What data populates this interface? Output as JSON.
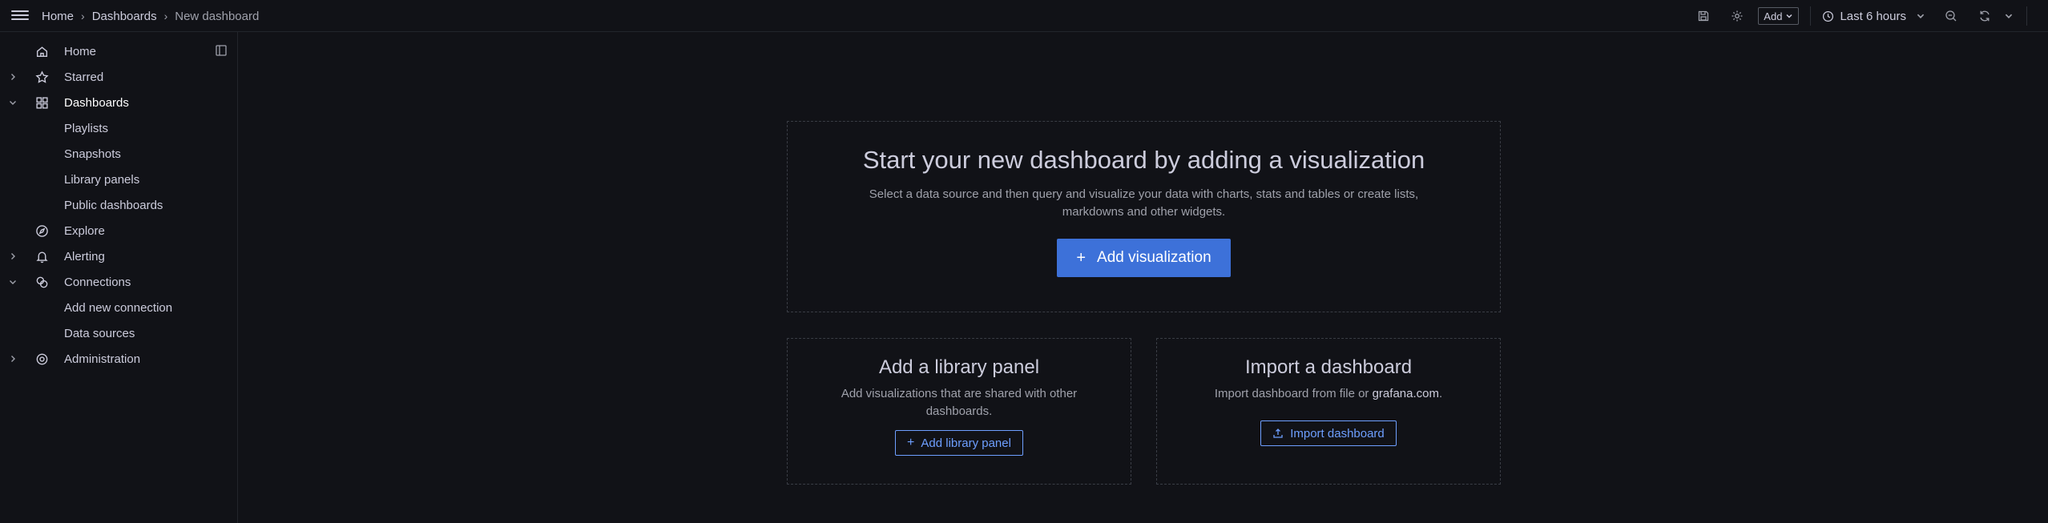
{
  "breadcrumb": {
    "home": "Home",
    "dashboards": "Dashboards",
    "current": "New dashboard"
  },
  "toolbar": {
    "add_label": "Add",
    "time_range": "Last 6 hours"
  },
  "sidebar": {
    "items": [
      {
        "label": "Home"
      },
      {
        "label": "Starred"
      },
      {
        "label": "Dashboards"
      },
      {
        "label": "Playlists"
      },
      {
        "label": "Snapshots"
      },
      {
        "label": "Library panels"
      },
      {
        "label": "Public dashboards"
      },
      {
        "label": "Explore"
      },
      {
        "label": "Alerting"
      },
      {
        "label": "Connections"
      },
      {
        "label": "Add new connection"
      },
      {
        "label": "Data sources"
      },
      {
        "label": "Administration"
      }
    ]
  },
  "main": {
    "title": "Start your new dashboard by adding a visualization",
    "description": "Select a data source and then query and visualize your data with charts, stats and tables or create lists, markdowns and other widgets.",
    "add_visualization": "Add visualization"
  },
  "library_panel": {
    "title": "Add a library panel",
    "description": "Add visualizations that are shared with other dashboards.",
    "button": "Add library panel"
  },
  "import_dashboard": {
    "title": "Import a dashboard",
    "description_prefix": "Import dashboard from file or ",
    "link": "grafana.com",
    "description_suffix": ".",
    "button": "Import dashboard"
  },
  "colors": {
    "background": "#111217",
    "primary": "#3d71d9",
    "link": "#6e9fff"
  }
}
